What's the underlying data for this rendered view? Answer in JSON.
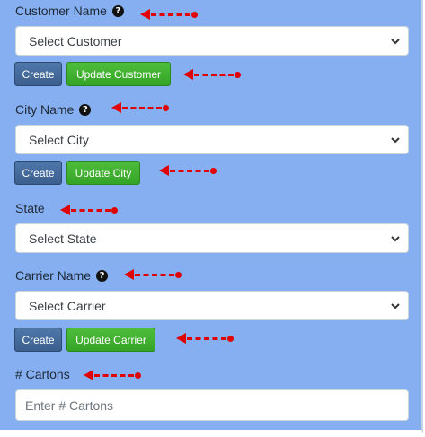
{
  "form": {
    "customer": {
      "label": "Customer Name",
      "help_icon": "question-circle-icon",
      "select_value": "Select Customer",
      "create_label": "Create",
      "update_label": "Update Customer"
    },
    "city": {
      "label": "City Name",
      "help_icon": "question-circle-icon",
      "select_value": "Select City",
      "create_label": "Create",
      "update_label": "Update City"
    },
    "state": {
      "label": "State",
      "select_value": "Select State"
    },
    "carrier": {
      "label": "Carrier Name",
      "help_icon": "question-circle-icon",
      "select_value": "Select Carrier",
      "create_label": "Create",
      "update_label": "Update Carrier"
    },
    "cartons": {
      "label": "# Cartons",
      "placeholder": "Enter # Cartons"
    }
  },
  "colors": {
    "panel_bg": "#85aff0",
    "arrow": "#e00000",
    "create_button": "#3b5f8e",
    "update_button": "#35a326"
  }
}
